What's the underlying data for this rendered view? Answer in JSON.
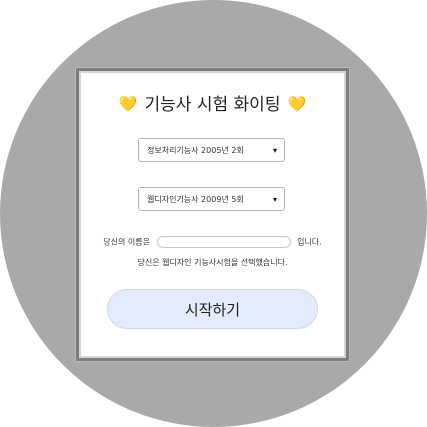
{
  "card": {
    "title": "기능사 시험 화이팅",
    "heart_left": "💛",
    "heart_right": "💛"
  },
  "exam_select_1": {
    "value": "정보처리기능사 2005년 2회"
  },
  "exam_select_2": {
    "value": "웹디자인기능사 2009년 5회"
  },
  "name_row": {
    "prefix": "당신의 이름은",
    "input_value": "",
    "suffix": "입니다."
  },
  "result_text": "당신은 웹디자인 기능사시험을 선택했습니다.",
  "start_button": {
    "label": "시작하기"
  },
  "colors": {
    "backdrop": "#a9a9a9",
    "button_bg": "#e2ecfc",
    "heart": "#f2c21a"
  }
}
